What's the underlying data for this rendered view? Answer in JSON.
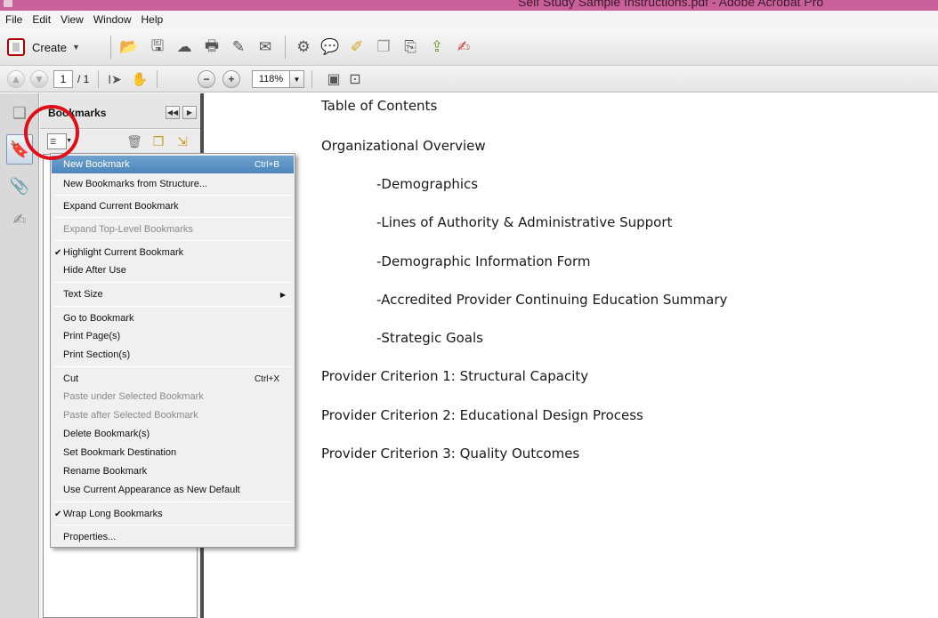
{
  "window": {
    "title": "Self Study Sample Instructions.pdf - Adobe Acrobat Pro"
  },
  "menubar": [
    "File",
    "Edit",
    "View",
    "Window",
    "Help"
  ],
  "toolbar": {
    "create_label": "Create",
    "icons": [
      "open-icon",
      "save-icon",
      "cloud-upload-icon",
      "print-icon",
      "edit-icon",
      "email-icon",
      "settings-icon",
      "comment-icon",
      "highlight-icon",
      "stamp-icon",
      "export-icon",
      "share-icon",
      "sign-icon"
    ]
  },
  "nav": {
    "page_current": "1",
    "page_total": "/ 1",
    "zoom": "118%"
  },
  "panel": {
    "title": "Bookmarks"
  },
  "menu": {
    "items": [
      {
        "label": "New Bookmark",
        "shortcut": "Ctrl+B",
        "highlighted": true
      },
      {
        "label": "New Bookmarks from Structure..."
      },
      {
        "label": "Expand Current Bookmark"
      },
      {
        "label": "Expand Top-Level Bookmarks",
        "disabled": true
      },
      {
        "label": "Highlight Current Bookmark",
        "checked": true
      },
      {
        "label": "Hide After Use"
      },
      {
        "label": "Text Size",
        "submenu": true
      },
      {
        "label": "Go to Bookmark"
      },
      {
        "label": "Print Page(s)"
      },
      {
        "label": "Print Section(s)"
      },
      {
        "label": "Cut",
        "shortcut": "Ctrl+X"
      },
      {
        "label": "Paste under Selected Bookmark",
        "disabled": true
      },
      {
        "label": "Paste after Selected Bookmark",
        "disabled": true
      },
      {
        "label": "Delete Bookmark(s)"
      },
      {
        "label": "Set Bookmark Destination"
      },
      {
        "label": "Rename Bookmark"
      },
      {
        "label": "Use Current Appearance as New Default"
      },
      {
        "label": "Wrap Long Bookmarks",
        "checked": true
      },
      {
        "label": "Properties..."
      }
    ]
  },
  "document": {
    "lines": [
      {
        "text": "Table of Contents",
        "indent": false
      },
      {
        "text": "Organizational Overview",
        "indent": false
      },
      {
        "text": "-Demographics",
        "indent": true
      },
      {
        "text": "-Lines of Authority & Administrative Support",
        "indent": true
      },
      {
        "text": "-Demographic Information Form",
        "indent": true
      },
      {
        "text": "-Accredited Provider Continuing Education Summary",
        "indent": true
      },
      {
        "text": "-Strategic Goals",
        "indent": true
      },
      {
        "text": "Provider Criterion 1: Structural Capacity",
        "indent": false
      },
      {
        "text": "Provider Criterion 2: Educational Design Process",
        "indent": false
      },
      {
        "text": "Provider Criterion 3: Quality Outcomes",
        "indent": false
      }
    ]
  },
  "annotation": {
    "color": "#e0101a"
  }
}
